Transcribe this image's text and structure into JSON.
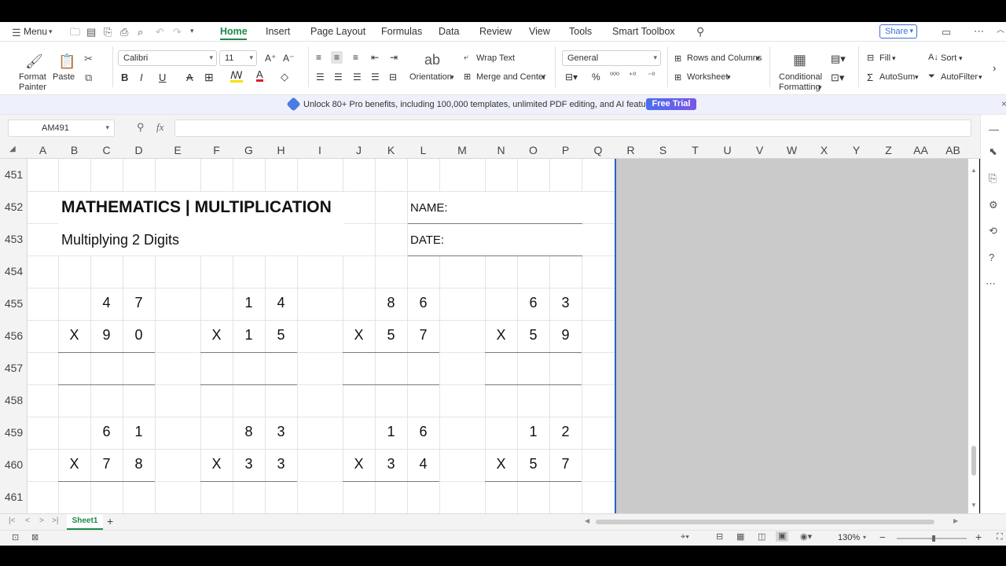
{
  "menu": {
    "label": "Menu"
  },
  "tabs": [
    "Home",
    "Insert",
    "Page Layout",
    "Formulas",
    "Data",
    "Review",
    "View",
    "Tools",
    "Smart Toolbox"
  ],
  "share": {
    "label": "Share"
  },
  "ribbon": {
    "format_painter": "Format Painter",
    "paste": "Paste",
    "font_name": "Calibri",
    "font_size": "11",
    "wrap_text": "Wrap Text",
    "orientation": "Orientation",
    "merge_center": "Merge and Center",
    "number_format": "General",
    "rows_columns": "Rows and Columns",
    "worksheet": "Worksheet",
    "conditional": "Conditional",
    "formatting": "Formatting",
    "fill": "Fill",
    "sort": "Sort",
    "autosum": "AutoSum",
    "autofilter": "AutoFilter"
  },
  "banner": {
    "text": "Unlock 80+ Pro benefits, including 100,000 templates, unlimited PDF editing, and AI features.",
    "button": "Free Trial"
  },
  "name_box": "AM491",
  "formula_fx": "fx",
  "columns": [
    "A",
    "B",
    "C",
    "D",
    "E",
    "F",
    "G",
    "H",
    "I",
    "J",
    "K",
    "L",
    "M",
    "N",
    "O",
    "P",
    "Q",
    "R",
    "S",
    "T",
    "U",
    "V",
    "W",
    "X",
    "Y",
    "Z",
    "AA",
    "AB"
  ],
  "rows": [
    "451",
    "452",
    "453",
    "454",
    "455",
    "456",
    "457",
    "458",
    "459",
    "460",
    "461"
  ],
  "sheet": {
    "title": "MATHEMATICS | MULTIPLICATION",
    "subtitle": "Multiplying 2 Digits",
    "name_label": "NAME:",
    "date_label": "DATE:",
    "problems": [
      {
        "top": [
          "4",
          "7"
        ],
        "bottom": [
          "9",
          "0"
        ]
      },
      {
        "top": [
          "1",
          "4"
        ],
        "bottom": [
          "1",
          "5"
        ]
      },
      {
        "top": [
          "8",
          "6"
        ],
        "bottom": [
          "5",
          "7"
        ]
      },
      {
        "top": [
          "6",
          "3"
        ],
        "bottom": [
          "5",
          "9"
        ]
      },
      {
        "top": [
          "6",
          "1"
        ],
        "bottom": [
          "7",
          "8"
        ]
      },
      {
        "top": [
          "8",
          "3"
        ],
        "bottom": [
          "3",
          "3"
        ]
      },
      {
        "top": [
          "1",
          "6"
        ],
        "bottom": [
          "3",
          "4"
        ]
      },
      {
        "top": [
          "1",
          "2"
        ],
        "bottom": [
          "5",
          "7"
        ]
      }
    ],
    "x_sign": "X"
  },
  "sheet_tab": "Sheet1",
  "zoom": "130%"
}
